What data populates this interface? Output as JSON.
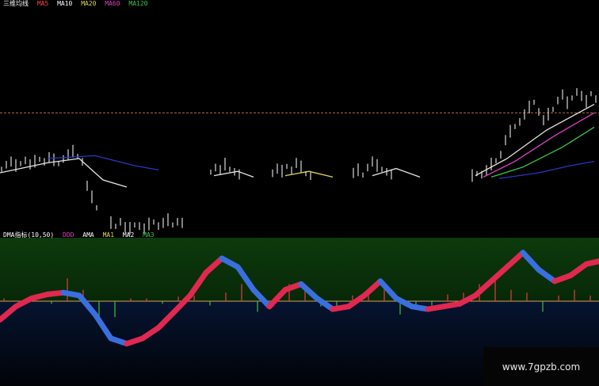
{
  "header": {
    "main_items": [
      "三维均线",
      "MA5",
      "MA10",
      "MA20",
      "MA60",
      "MA120"
    ],
    "indicator_items": [
      "DMA指标(10,50)",
      "DDD",
      "AMA",
      "MA1",
      "MA2",
      "MA3"
    ]
  },
  "watermark": "www.7gpzb.com",
  "colors": {
    "background": "#000000",
    "candle_up": "#ffffff",
    "ma_white": "#e6e6e6",
    "ma_yellow": "#e0d84a",
    "ma_magenta": "#e040c0",
    "ma_green": "#38c848",
    "ma_blue": "#2838c0",
    "ref_line": "#b46a4a",
    "ribbon_up": "#e02850",
    "ribbon_down": "#3a6fe0",
    "bar_up": "#e04040",
    "bar_down": "#40c040",
    "zero_line": "#d7a050",
    "panel_green": "#0c3a0c",
    "panel_navy": "#061430"
  },
  "chart_data": [
    {
      "type": "line",
      "panel": "price",
      "x": [
        0,
        6,
        12,
        18,
        24,
        30,
        36,
        42,
        48,
        54,
        60,
        66,
        72,
        78,
        84,
        90,
        96,
        102,
        108,
        114,
        120,
        126,
        132,
        138,
        144,
        150,
        156,
        162,
        168,
        174,
        180,
        186,
        192,
        198,
        204,
        210,
        216,
        222,
        228,
        234,
        240,
        246,
        252,
        258,
        264,
        270,
        276,
        282,
        288,
        294,
        300,
        306,
        312,
        318,
        324,
        330,
        336,
        342,
        348,
        354,
        360,
        366,
        372,
        378,
        384,
        390,
        396,
        402,
        408,
        414,
        420,
        426,
        432,
        438,
        444,
        450,
        456,
        462,
        468,
        474,
        480,
        486,
        492,
        498,
        504,
        510,
        516,
        522,
        528,
        534,
        540,
        546,
        552,
        558,
        564,
        570,
        576,
        582,
        588,
        594,
        600,
        606,
        612,
        618,
        624,
        630,
        636,
        642,
        648,
        654,
        660,
        666,
        672,
        678,
        684,
        690,
        696,
        702,
        708,
        714,
        720,
        726,
        732,
        738,
        744,
        750
      ],
      "close": [
        0.42,
        0.45,
        0.47,
        0.44,
        0.46,
        0.48,
        0.45,
        0.47,
        0.49,
        0.47,
        0.5,
        0.48,
        0.46,
        0.49,
        0.52,
        0.54,
        0.51,
        0.47,
        0.3,
        0.22,
        0.15,
        null,
        null,
        0.04,
        0.02,
        0.05,
        0.01,
        0.0,
        0.03,
        0.02,
        0.0,
        0.03,
        0.05,
        0.02,
        0.04,
        0.06,
        0.03,
        0.05,
        0.04,
        null,
        null,
        null,
        null,
        null,
        0.4,
        0.43,
        0.41,
        0.45,
        0.42,
        0.4,
        0.38,
        null,
        null,
        null,
        null,
        null,
        null,
        0.39,
        0.42,
        0.4,
        0.44,
        0.41,
        0.46,
        0.43,
        0.39,
        0.37,
        null,
        null,
        null,
        null,
        null,
        null,
        null,
        null,
        0.39,
        0.41,
        0.38,
        0.43,
        0.47,
        0.44,
        0.42,
        0.4,
        0.38,
        null,
        null,
        null,
        null,
        null,
        null,
        null,
        null,
        null,
        null,
        null,
        null,
        null,
        null,
        null,
        null,
        0.37,
        0.39,
        0.38,
        0.41,
        0.45,
        0.48,
        0.52,
        0.62,
        0.68,
        0.72,
        0.75,
        0.8,
        0.85,
        0.89,
        0.82,
        0.76,
        0.8,
        0.84,
        0.9,
        0.94,
        0.88,
        0.92,
        0.96,
        0.93,
        0.89,
        0.95,
        0.91
      ],
      "reference_y": 0.82,
      "series": [
        {
          "color_key": "ma_white",
          "points": [
            [
              0,
              0.4
            ],
            [
              60,
              0.47
            ],
            [
              100,
              0.5
            ],
            [
              130,
              0.35
            ],
            [
              160,
              0.3
            ]
          ]
        },
        {
          "color_key": "ma_blue",
          "points": [
            [
              60,
              0.5
            ],
            [
              120,
              0.52
            ],
            [
              170,
              0.45
            ],
            [
              200,
              0.42
            ]
          ]
        },
        {
          "color_key": "ma_white",
          "points": [
            [
              270,
              0.38
            ],
            [
              300,
              0.41
            ],
            [
              320,
              0.37
            ]
          ]
        },
        {
          "color_key": "ma_yellow",
          "points": [
            [
              360,
              0.38
            ],
            [
              390,
              0.41
            ],
            [
              420,
              0.37
            ]
          ]
        },
        {
          "color_key": "ma_white",
          "points": [
            [
              470,
              0.38
            ],
            [
              500,
              0.43
            ],
            [
              530,
              0.37
            ]
          ]
        },
        {
          "color_key": "ma_white",
          "points": [
            [
              600,
              0.38
            ],
            [
              640,
              0.5
            ],
            [
              690,
              0.7
            ],
            [
              750,
              0.88
            ]
          ]
        },
        {
          "color_key": "ma_magenta",
          "points": [
            [
              610,
              0.37
            ],
            [
              650,
              0.48
            ],
            [
              700,
              0.66
            ],
            [
              750,
              0.82
            ]
          ]
        },
        {
          "color_key": "ma_green",
          "points": [
            [
              620,
              0.37
            ],
            [
              660,
              0.44
            ],
            [
              710,
              0.58
            ],
            [
              750,
              0.72
            ]
          ]
        },
        {
          "color_key": "ma_blue",
          "points": [
            [
              630,
              0.36
            ],
            [
              680,
              0.4
            ],
            [
              720,
              0.45
            ],
            [
              750,
              0.48
            ]
          ]
        }
      ]
    },
    {
      "type": "area",
      "panel": "indicator",
      "x": [
        0,
        20,
        40,
        60,
        80,
        100,
        120,
        140,
        160,
        180,
        200,
        220,
        240,
        260,
        280,
        300,
        320,
        340,
        360,
        380,
        400,
        420,
        440,
        460,
        480,
        500,
        520,
        540,
        560,
        580,
        600,
        620,
        640,
        660,
        680,
        700,
        720,
        740,
        756
      ],
      "ribbon": [
        -0.35,
        -0.1,
        0.05,
        0.12,
        0.15,
        0.1,
        -0.25,
        -0.7,
        -0.8,
        -0.7,
        -0.5,
        -0.2,
        0.1,
        0.5,
        0.75,
        0.6,
        0.2,
        -0.1,
        0.2,
        0.3,
        0.05,
        -0.15,
        -0.1,
        0.1,
        0.35,
        0.05,
        -0.1,
        -0.15,
        -0.1,
        -0.05,
        0.1,
        0.35,
        0.6,
        0.85,
        0.55,
        0.35,
        0.45,
        0.65,
        0.7
      ],
      "bars": [
        0.05,
        -0.08,
        0.12,
        -0.05,
        0.4,
        0.2,
        -0.4,
        -0.3,
        0.05,
        0.05,
        -0.05,
        0.08,
        0.1,
        -0.08,
        0.15,
        0.3,
        -0.2,
        -0.1,
        0.3,
        0.2,
        -0.1,
        -0.15,
        0.1,
        0.2,
        0.3,
        -0.25,
        -0.1,
        -0.08,
        0.12,
        0.15,
        0.3,
        0.4,
        0.2,
        0.15,
        -0.2,
        0.1,
        0.2,
        0.1,
        0.05
      ],
      "ylim": [
        -1,
        1
      ]
    }
  ]
}
